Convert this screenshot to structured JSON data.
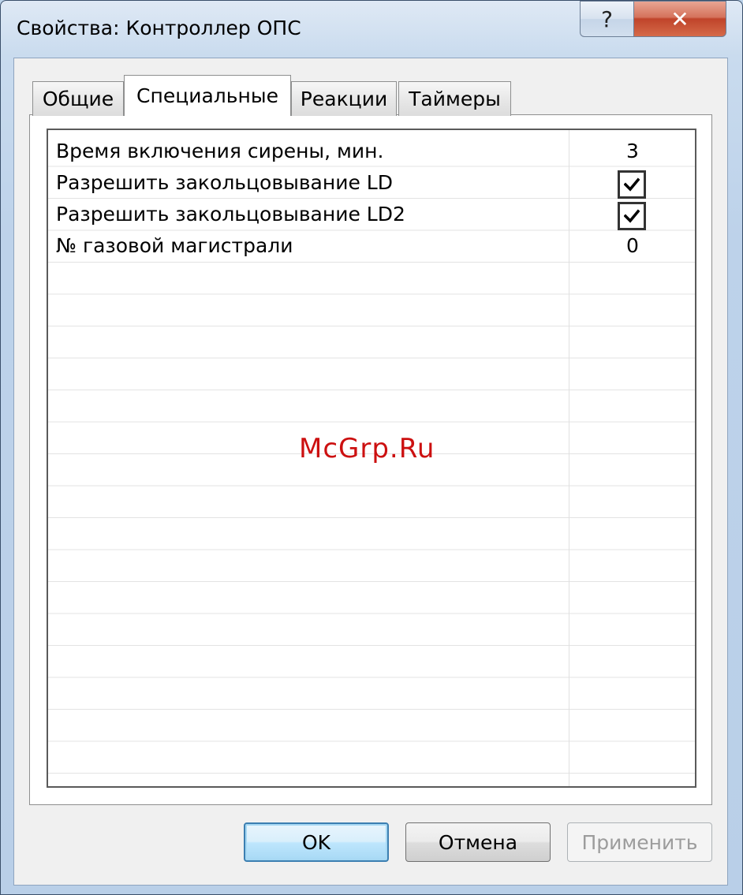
{
  "window": {
    "title": "Свойства: Контроллер ОПС",
    "help_glyph": "?",
    "close_glyph": "✕"
  },
  "tabs": [
    {
      "label": "Общие",
      "active": false
    },
    {
      "label": "Специальные",
      "active": true
    },
    {
      "label": "Реакции",
      "active": false
    },
    {
      "label": "Таймеры",
      "active": false
    }
  ],
  "properties": [
    {
      "label": "Время включения сирены, мин.",
      "type": "number",
      "value": "3"
    },
    {
      "label": "Разрешить закольцовывание LD",
      "type": "checkbox",
      "checked": true
    },
    {
      "label": "Разрешить закольцовывание LD2",
      "type": "checkbox",
      "checked": true
    },
    {
      "label": "№ газовой магистрали",
      "type": "number",
      "value": "0"
    }
  ],
  "watermark": "McGrp.Ru",
  "buttons": {
    "ok": "OK",
    "cancel": "Отмена",
    "apply": "Применить",
    "apply_enabled": false
  },
  "icons": {
    "help": "help-icon",
    "close": "close-icon",
    "check": "checkmark-icon"
  },
  "colors": {
    "title_bar": "#c9dbee",
    "close_button": "#c0442a",
    "default_button_border": "#3c7fb1",
    "watermark": "#cc1010"
  }
}
